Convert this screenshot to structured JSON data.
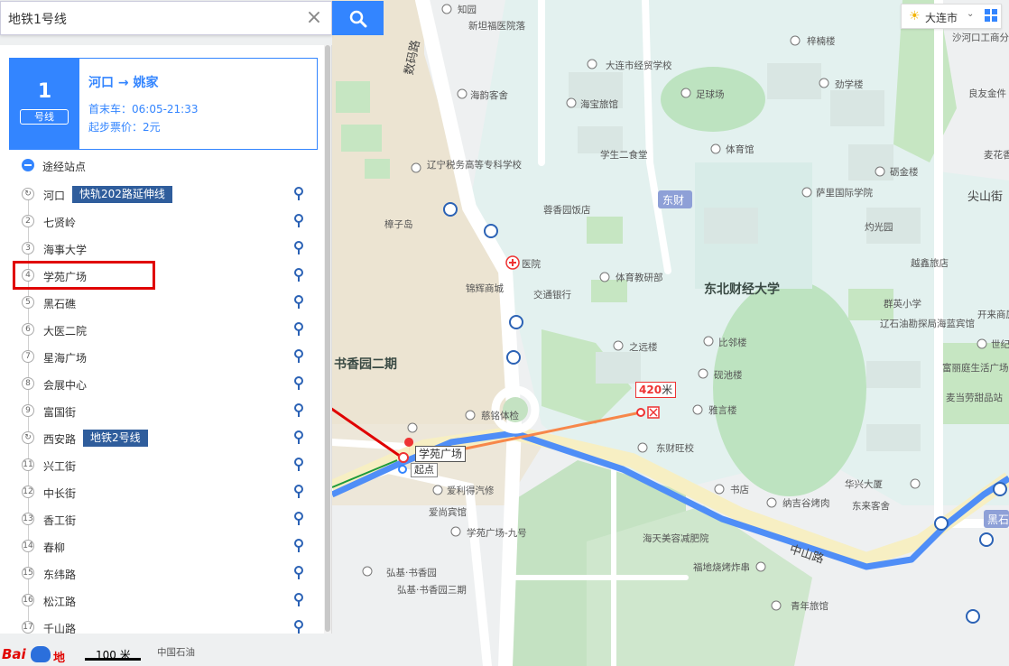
{
  "search": {
    "value": "地铁1号线"
  },
  "city": {
    "name": "大连市"
  },
  "line": {
    "number": "1",
    "tag": "号线",
    "route": "河口 → 姚家",
    "hours": "首末车：06:05-21:33",
    "fare": "起步票价：2元"
  },
  "stops_header": "途经站点",
  "stops": [
    {
      "idx": "↻",
      "name": "河口",
      "transfer": "快轨202路延伸线"
    },
    {
      "idx": "2",
      "name": "七贤岭"
    },
    {
      "idx": "3",
      "name": "海事大学"
    },
    {
      "idx": "4",
      "name": "学苑广场"
    },
    {
      "idx": "5",
      "name": "黑石礁"
    },
    {
      "idx": "6",
      "name": "大医二院"
    },
    {
      "idx": "7",
      "name": "星海广场"
    },
    {
      "idx": "8",
      "name": "会展中心"
    },
    {
      "idx": "9",
      "name": "富国街"
    },
    {
      "idx": "↻",
      "name": "西安路",
      "transfer": "地铁2号线"
    },
    {
      "idx": "11",
      "name": "兴工街"
    },
    {
      "idx": "12",
      "name": "中长街"
    },
    {
      "idx": "13",
      "name": "香工街"
    },
    {
      "idx": "14",
      "name": "春柳"
    },
    {
      "idx": "15",
      "name": "东纬路"
    },
    {
      "idx": "16",
      "name": "松江路"
    },
    {
      "idx": "17",
      "name": "千山路"
    }
  ],
  "map": {
    "distance_value": "420",
    "distance_unit": "米",
    "station_tag": "学苑广场",
    "start_tag": "起点",
    "labels": {
      "shuma_road": "数码路",
      "zhongshan_road": "中山路",
      "dongcai": "东财",
      "dufe": "东北财经大学",
      "shuxiang": "书香园二期",
      "jian": "尖山街",
      "hushi": "黑石",
      "zhiguang": "知园",
      "xintan": "新坦福医院落",
      "zhangtan": "樟子岛",
      "daxian": "大连市经贸学校",
      "zuqiu": "足球场",
      "jingshao": "劲学楼",
      "tiyuguan": "体育馆",
      "xsst": "学生二食堂",
      "haiyun": "海韵客舍",
      "haibao": "海宝旅馆",
      "liaoning": "辽宁税务高等专科学校",
      "yijinlou": "砺金楼",
      "salixue": "萨里国际学院",
      "zhuoguang": "灼光园",
      "rongxiang": "蓉香园饭店",
      "yiyuan": "医院",
      "jiaotong": "交通银行",
      "tiyujiaoyan": "体育教研部",
      "jinhui": "锦辉商城",
      "qunying": "群英小学",
      "liaoshi": "辽石油勘探局海蓝宾馆",
      "zhiyuan": "之远楼",
      "bilin": "比邻楼",
      "yanchi": "砚池楼",
      "yaxin": "雅言楼",
      "cixiang": "慈铭体检",
      "dcwang": "东财旺校",
      "shudian": "书店",
      "najipu": "纳吉谷烤肉",
      "huaxing": "华兴大厦",
      "dongke": "东来客舍",
      "ailishi": "爱利得汽修",
      "aibinguan": "爱尚宾馆",
      "xyjiuhao": "学苑广场-九号",
      "haitian": "海天美容减肥院",
      "fudi": "福地烧烤炸串",
      "qingnian": "青年旅馆",
      "hongjishu": "弘基·书香园",
      "hongjishu3": "弘基·书香园三期",
      "zhongguoshiyou": "中国石油",
      "shahekou": "沙河口工商分局",
      "zijin": "梓楠楼",
      "yuefu": "越鑫旅店",
      "fuligong": "富丽庭生活广场",
      "maihong": "麦当劳甜品站",
      "kaile": "开来商厦",
      "gaoqing": "良友金件",
      "huanghua": "麦花香",
      "shibao": "世纪"
    }
  },
  "scale": {
    "label": "100 米"
  },
  "logo": {
    "left": "Bai",
    "right": "地图"
  },
  "colors": {
    "accent": "#3385ff",
    "highlight": "#e00000",
    "transfer": "#2f5d9c"
  }
}
